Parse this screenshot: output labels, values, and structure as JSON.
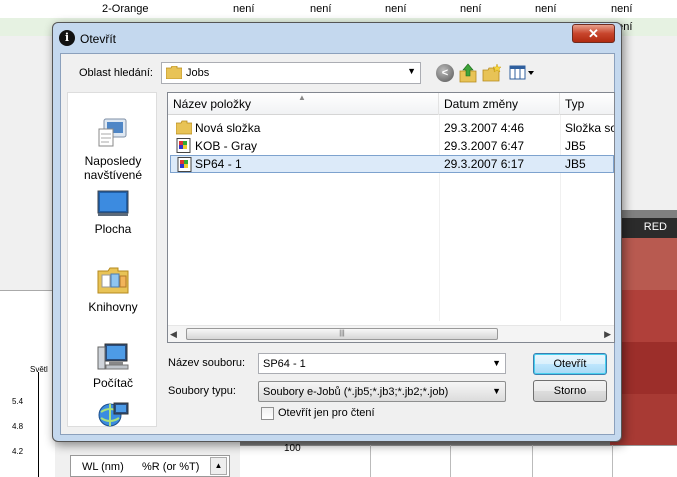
{
  "background": {
    "rows": [
      {
        "name": "2-Orange",
        "values": [
          "není",
          "není",
          "není",
          "není",
          "není",
          "není"
        ]
      },
      {
        "name": "",
        "values": [
          "",
          "",
          "",
          "",
          "",
          "není"
        ]
      }
    ],
    "red_header": "RED",
    "axis_top_label": "Světl",
    "y_ticks": [
      "5.4",
      "4.8",
      "4.2"
    ],
    "graph_label": "100",
    "table_headers": [
      "WL (nm)",
      "%R (or %T)"
    ],
    "colors": {
      "swatch1": "#b85a50",
      "swatch2": "#b0403a",
      "swatch3": "#9c2e2a",
      "swatch4": "#a83a34"
    }
  },
  "dialog": {
    "title": "Otevřít",
    "close_symbol": "✕",
    "look_in_label": "Oblast hledání:",
    "look_in_value": "Jobs",
    "places": [
      {
        "icon": "recent-places-icon",
        "label": "Naposledy navštívené"
      },
      {
        "icon": "desktop-icon",
        "label": "Plocha"
      },
      {
        "icon": "libraries-icon",
        "label": "Knihovny"
      },
      {
        "icon": "computer-icon",
        "label": "Počítač"
      },
      {
        "icon": "network-icon",
        "label": ""
      }
    ],
    "columns": [
      "Název položky",
      "Datum změny",
      "Typ"
    ],
    "files": [
      {
        "icon": "folder-icon",
        "name": "Nová složka",
        "date": "29.3.2007 4:46",
        "type": "Složka sou"
      },
      {
        "icon": "jb5-file-icon",
        "name": "KOB - Gray",
        "date": "29.3.2007 6:47",
        "type": "JB5"
      },
      {
        "icon": "jb5-file-icon",
        "name": "SP64 - 1",
        "date": "29.3.2007 6:17",
        "type": "JB5",
        "selected": true
      }
    ],
    "filename_label": "Název souboru:",
    "filename_value": "SP64 - 1",
    "filetype_label": "Soubory typu:",
    "filetype_value": "Soubory e-Jobů (*.jb5;*.jb3;*.jb2;*.job)",
    "readonly_label": "Otevřít jen pro čtení",
    "readonly_checked": false,
    "open_button": "Otevřít",
    "cancel_button": "Storno"
  }
}
